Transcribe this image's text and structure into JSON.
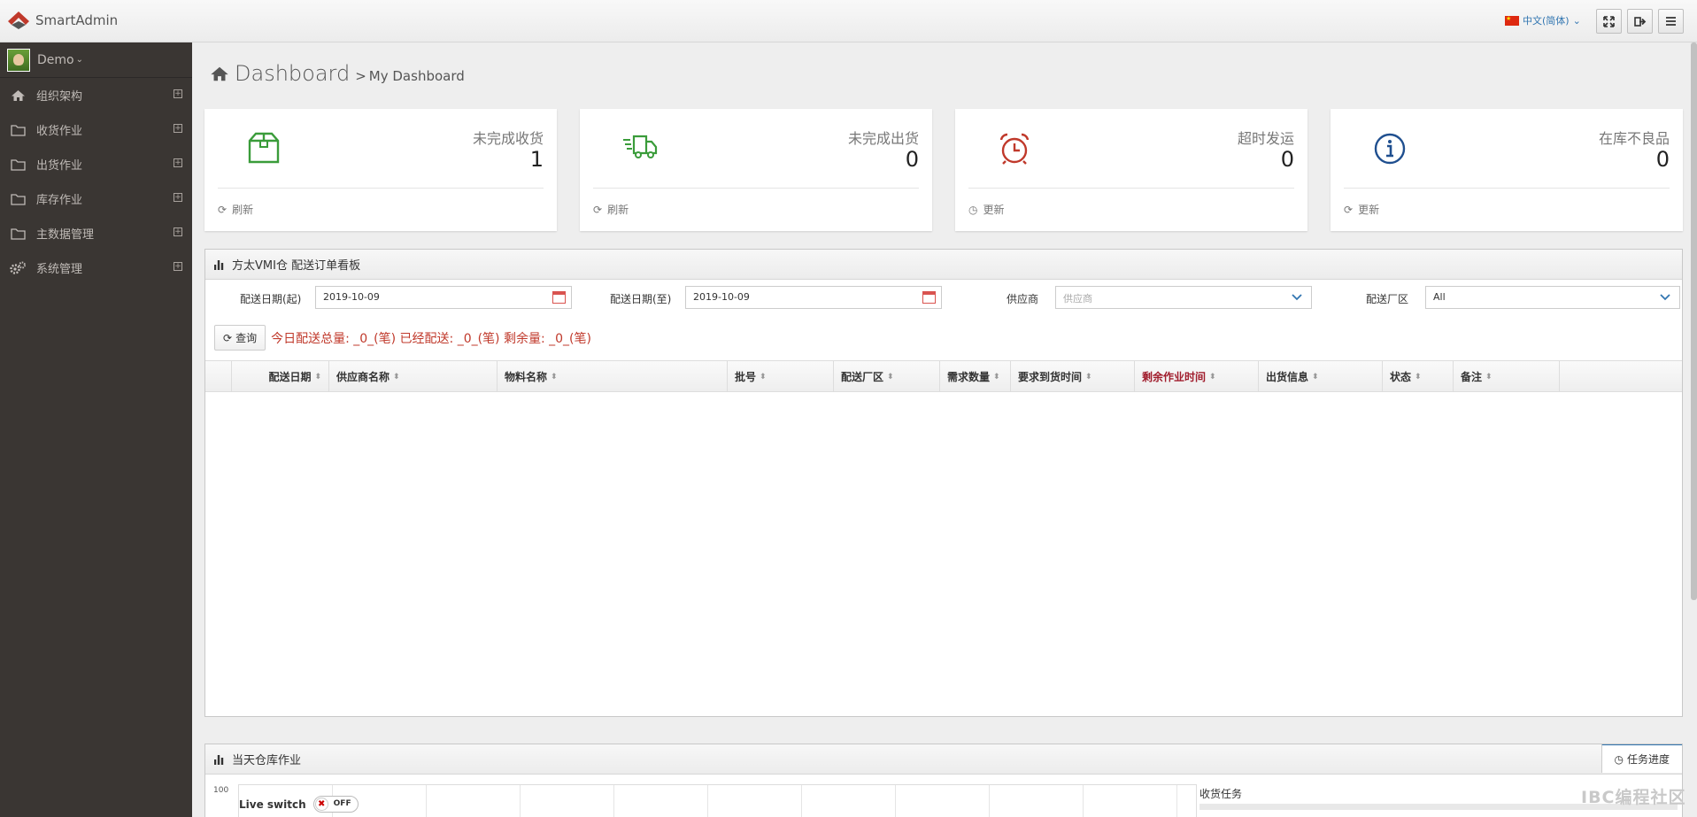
{
  "header": {
    "app_name": "SmartAdmin",
    "language": "中文(简体)",
    "buttons": [
      "fullscreen-icon",
      "logout-icon",
      "menu-icon"
    ]
  },
  "sidebar": {
    "user": "Demo",
    "items": [
      {
        "label": "组织架构",
        "icon": "home-icon"
      },
      {
        "label": "收货作业",
        "icon": "folder-icon"
      },
      {
        "label": "出货作业",
        "icon": "folder-icon"
      },
      {
        "label": "库存作业",
        "icon": "folder-icon"
      },
      {
        "label": "主数据管理",
        "icon": "folder-icon"
      },
      {
        "label": "系统管理",
        "icon": "gears-icon"
      }
    ]
  },
  "breadcrumb": {
    "title": "Dashboard",
    "sep": ">",
    "sub": "My Dashboard"
  },
  "cards": [
    {
      "label": "未完成收货",
      "value": "1",
      "footer": "刷新",
      "icon": "box-icon",
      "color": "#3a9c3a"
    },
    {
      "label": "未完成出货",
      "value": "0",
      "footer": "刷新",
      "icon": "truck-icon",
      "color": "#3a9c3a"
    },
    {
      "label": "超时发运",
      "value": "0",
      "footer": "更新",
      "icon": "alarm-clock-icon",
      "color": "#c0392b"
    },
    {
      "label": "在库不良品",
      "value": "0",
      "footer": "更新",
      "icon": "info-icon",
      "color": "#1f4f8f"
    }
  ],
  "order_panel": {
    "title": "方太VMI仓 配送订单看板",
    "filters": {
      "start_label": "配送日期(起)",
      "start_value": "2019-10-09",
      "end_label": "配送日期(至)",
      "end_value": "2019-10-09",
      "supplier_label": "供应商",
      "supplier_placeholder": "供应商",
      "zone_label": "配送厂区",
      "zone_value": "All"
    },
    "query_button": "查询",
    "summary": "今日配送总量: _0_(笔) 已经配送: _0_(笔) 剩余量: _0_(笔)",
    "columns": [
      "配送日期",
      "供应商名称",
      "物料名称",
      "批号",
      "配送厂区",
      "需求数量",
      "要求到货时间",
      "剩余作业时间",
      "出货信息",
      "状态",
      "备注"
    ],
    "highlight_column_color": "#a01c2c"
  },
  "warehouse_panel": {
    "title": "当天仓库作业",
    "tab": "任务进度",
    "y_tick": "100",
    "live_switch_label": "Live switch",
    "toggle_state": "OFF",
    "task_label": "收货任务"
  },
  "watermark": "IBC编程社区"
}
